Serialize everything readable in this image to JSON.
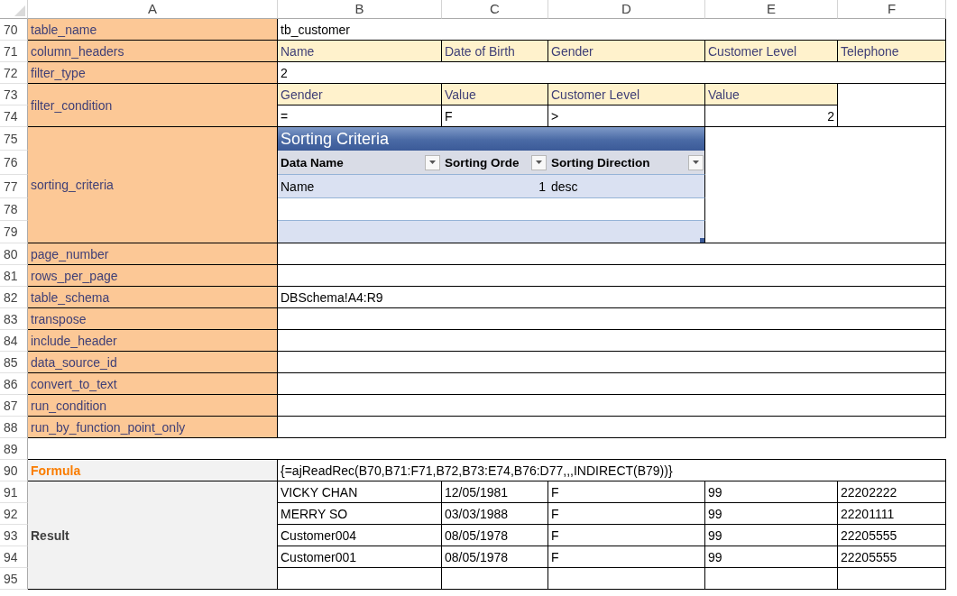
{
  "column_letters": [
    "A",
    "B",
    "C",
    "D",
    "E",
    "F"
  ],
  "row_numbers": [
    "70",
    "71",
    "72",
    "73",
    "74",
    "75",
    "76",
    "77",
    "78",
    "79",
    "80",
    "81",
    "82",
    "83",
    "84",
    "85",
    "86",
    "87",
    "88",
    "89",
    "90",
    "91",
    "92",
    "93",
    "94",
    "95"
  ],
  "parameters": [
    {
      "kind": "text",
      "name": "table_name",
      "value": "tb_customer"
    },
    {
      "kind": "header_list",
      "name": "column_headers",
      "values": [
        "Name",
        "Date of Birth",
        "Gender",
        "Customer Level",
        "Telephone"
      ]
    },
    {
      "kind": "text",
      "name": "filter_type",
      "value": "2"
    },
    {
      "kind": "condition",
      "name": "filter_condition",
      "headers": [
        "Gender",
        "Value",
        "Customer Level",
        "Value"
      ],
      "values": [
        "=",
        "F",
        ">",
        "2"
      ]
    },
    {
      "kind": "table",
      "name": "sorting_criteria",
      "title": "Sorting Criteria",
      "columns": [
        {
          "label": "Data Name"
        },
        {
          "label": "Sorting Orde"
        },
        {
          "label": "Sorting Direction"
        }
      ],
      "rows": [
        [
          "Name",
          "1",
          "desc"
        ]
      ]
    },
    {
      "kind": "empty",
      "name": "page_number"
    },
    {
      "kind": "empty",
      "name": "rows_per_page"
    },
    {
      "kind": "text",
      "name": "table_schema",
      "value": "DBSchema!A4:R9"
    },
    {
      "kind": "empty",
      "name": "transpose"
    },
    {
      "kind": "empty",
      "name": "include_header"
    },
    {
      "kind": "empty",
      "name": "data_source_id"
    },
    {
      "kind": "empty",
      "name": "convert_to_text"
    },
    {
      "kind": "empty",
      "name": "run_condition"
    },
    {
      "kind": "empty",
      "name": "run_by_function_point_only"
    }
  ],
  "formula": {
    "label": "Formula",
    "value": "{=ajReadRec(B70,B71:F71,B72,B73:E74,B76:D77,,,INDIRECT(B79))}"
  },
  "result": {
    "label": "Result",
    "rows": [
      [
        "VICKY CHAN",
        "12/05/1981",
        "F",
        "99",
        "22202222"
      ],
      [
        "MERRY SO",
        "03/03/1988",
        "F",
        "99",
        "22201111"
      ],
      [
        "Customer004",
        "08/05/1978",
        "F",
        "99",
        "22205555"
      ],
      [
        "Customer001",
        "08/05/1978",
        "F",
        "99",
        "22205555"
      ]
    ]
  }
}
